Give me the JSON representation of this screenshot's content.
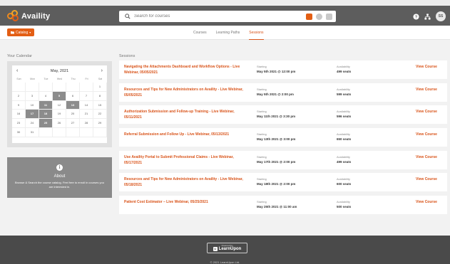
{
  "app": {
    "logo_text": "Availity",
    "brand_color": "#e35e14",
    "avatar_initials": "SS"
  },
  "search": {
    "placeholder": "Search for courses"
  },
  "subnav": {
    "catalog_label": "Catalog",
    "tabs": [
      {
        "label": "Courses",
        "active": false
      },
      {
        "label": "Learning Paths",
        "active": false
      },
      {
        "label": "Sessions",
        "active": true
      }
    ]
  },
  "calendar": {
    "heading": "Your Calendar",
    "month": "May, 2021",
    "weekdays": [
      "Sun",
      "Mon",
      "Tue",
      "Wed",
      "Thu",
      "Fri",
      "Sat"
    ],
    "days": [
      "",
      "",
      "",
      "",
      "",
      "",
      "1",
      "2",
      "3",
      "4",
      "5",
      "6",
      "7",
      "8",
      "9",
      "10",
      "11",
      "12",
      "13",
      "14",
      "15",
      "16",
      "17",
      "18",
      "19",
      "20",
      "21",
      "22",
      "23",
      "24",
      "25",
      "26",
      "27",
      "28",
      "29",
      "30",
      "31",
      "",
      "",
      "",
      "",
      ""
    ],
    "marked_days": [
      "5",
      "11",
      "13",
      "17",
      "18",
      "25"
    ]
  },
  "about": {
    "title": "About",
    "text": "Browse & Search the course catalog. Feel free to enroll in courses you are interested in."
  },
  "sessions": {
    "heading": "Sessions",
    "starting_label": "Starting",
    "availability_label": "Availability",
    "view_label": "View Course",
    "items": [
      {
        "title": "Navigating the Attachments Dashboard and Workflow Options - Live Webinar, 05/05/2021",
        "starting": "May 5th 2021 @ 12:00 pm",
        "seats": "499 seats"
      },
      {
        "title": "Resources and Tips for New Administrators on Availity - Live Webinar, 05/05/2021",
        "starting": "May 5th 2021 @ 2:00 pm",
        "seats": "599 seats"
      },
      {
        "title": "Authorization Submission and Follow-up Training - Live Webinar, 05/11/2021",
        "starting": "May 11th 2021 @ 3:30 pm",
        "seats": "596 seats"
      },
      {
        "title": "Referral Submission and Follow Up - Live Webinar, 05/13/2021",
        "starting": "May 13th 2021 @ 3:00 pm",
        "seats": "650 seats"
      },
      {
        "title": "Use Availity Portal to Submit Professional Claims - Live Webinar, 05/17/2021",
        "starting": "May 17th 2021 @ 2:00 pm",
        "seats": "499 seats"
      },
      {
        "title": "Resources and Tips for New Administrators on Availity - Live Webinar, 05/18/2021",
        "starting": "May 18th 2021 @ 2:00 pm",
        "seats": "600 seats"
      },
      {
        "title": "Patient Cost Estimator – Live Webinar, 05/25/2021",
        "starting": "May 25th 2021 @ 11:00 am",
        "seats": "500 seats"
      }
    ]
  },
  "footer": {
    "powered_by": "Powered by",
    "powered_logo": "LearnUpon",
    "copyright": "© 2021 LearnUpon Ltd."
  }
}
